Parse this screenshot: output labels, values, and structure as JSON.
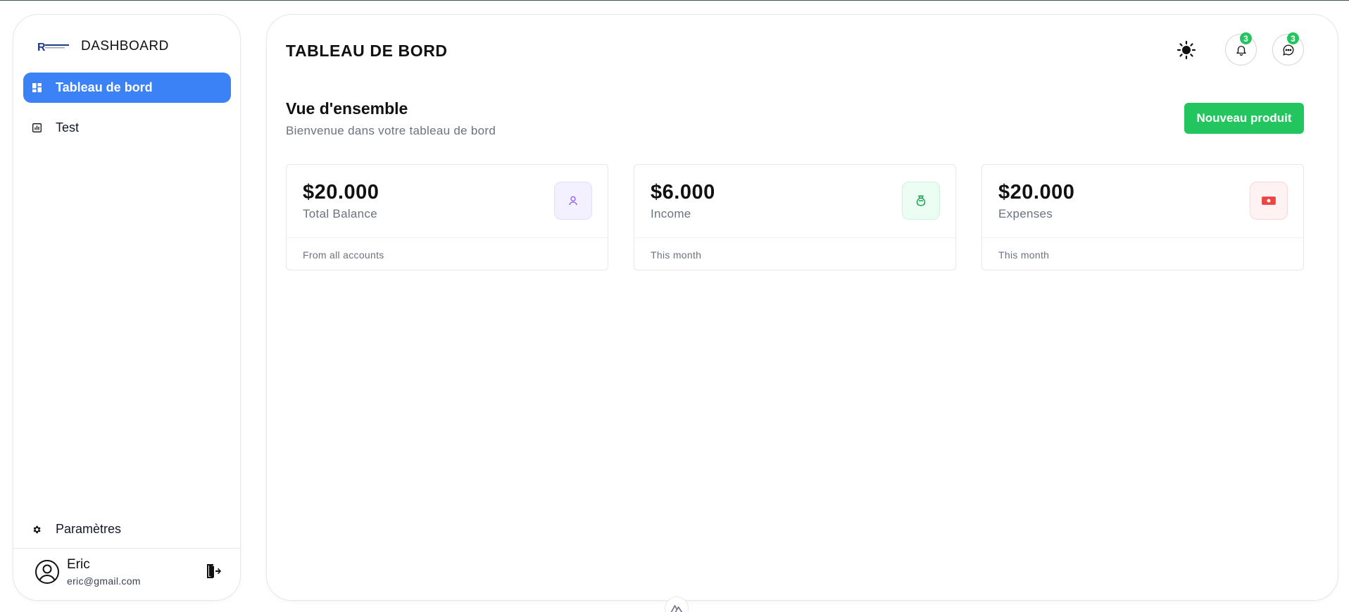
{
  "sidebar": {
    "brand_title": "DASHBOARD",
    "brand_logo": "readymade-logo",
    "nav": [
      {
        "label": "Tableau de bord",
        "icon": "dashboard-grid-icon",
        "active": true
      },
      {
        "label": "Test",
        "icon": "chart-icon",
        "active": false
      }
    ],
    "settings_label": "Paramètres",
    "user": {
      "name": "Eric",
      "email": "eric@gmail.com",
      "avatar_icon": "user-circle-icon"
    },
    "logout_icon": "logout-door-icon"
  },
  "header": {
    "title": "TABLEAU DE BORD",
    "theme_icon": "sun-icon",
    "notifications": {
      "icon": "bell-icon",
      "count": "3"
    },
    "messages": {
      "icon": "chat-bubble-icon",
      "count": "3"
    }
  },
  "overview": {
    "title": "Vue d'ensemble",
    "subtitle": "Bienvenue dans votre tableau de bord",
    "new_button": "Nouveau produit"
  },
  "cards": [
    {
      "value": "$20.000",
      "label": "Total Balance",
      "footer": "From all accounts",
      "icon": "user-icon",
      "accent": "#8b5cf6",
      "bg": "#f3f0ff"
    },
    {
      "value": "$6.000",
      "label": "Income",
      "footer": "This month",
      "icon": "money-bag-icon",
      "accent": "#22c55e",
      "bg": "#ecfdf3"
    },
    {
      "value": "$20.000",
      "label": "Expenses",
      "footer": "This month",
      "icon": "banknote-icon",
      "accent": "#ef4444",
      "bg": "#fef2f2"
    }
  ],
  "colors": {
    "primary": "#3b82f6",
    "success": "#22c55e",
    "border": "#e5e7eb",
    "muted": "#6b7280"
  }
}
